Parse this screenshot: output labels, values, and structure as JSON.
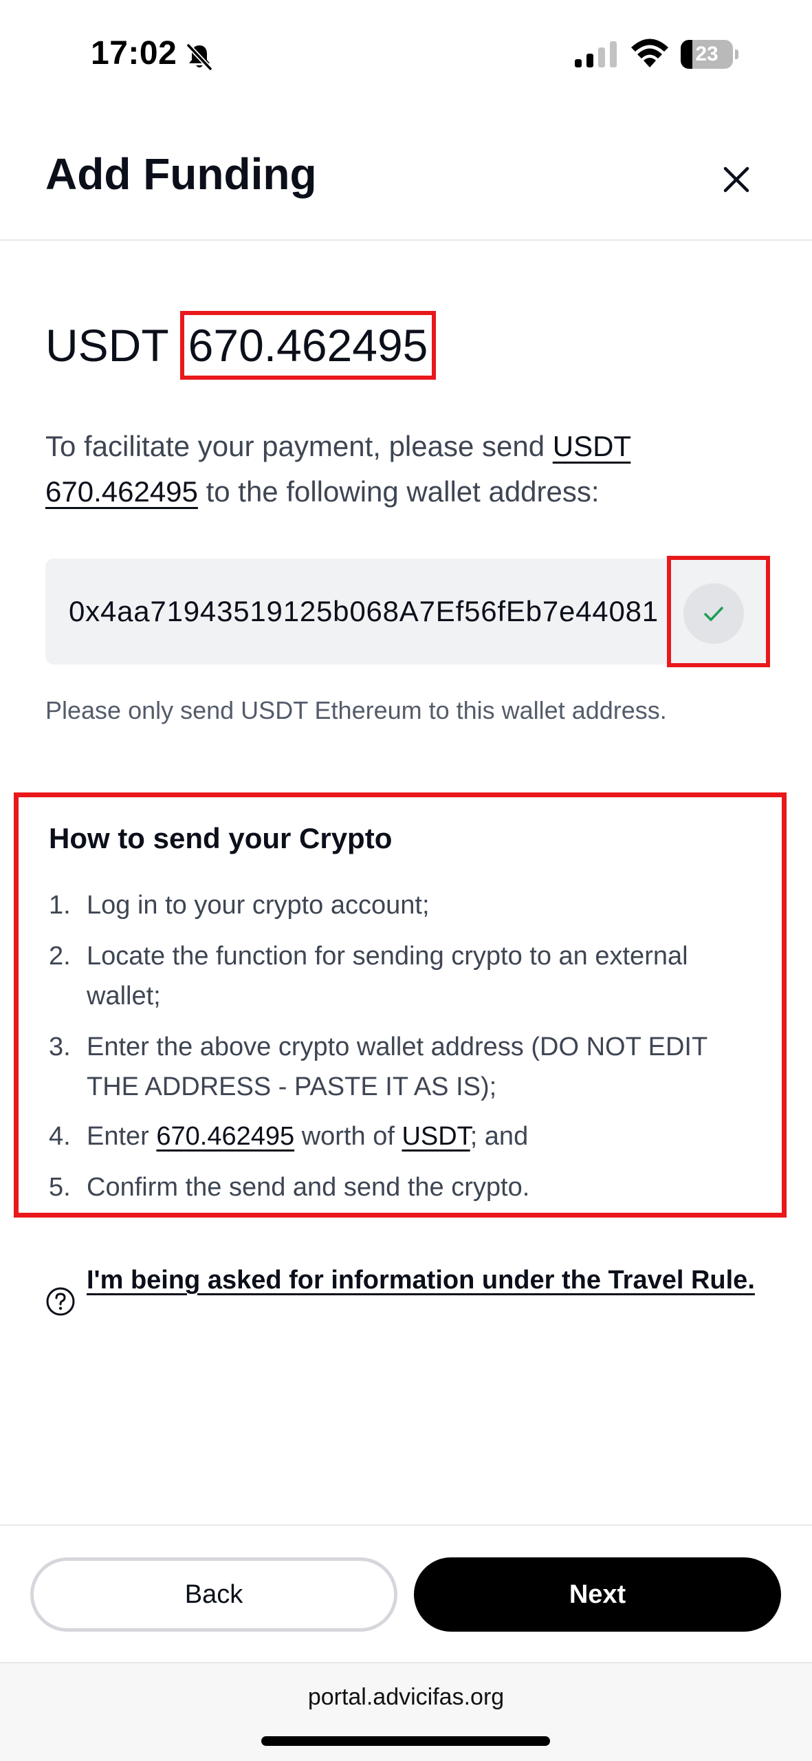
{
  "status_bar": {
    "time": "17:02",
    "battery_level": "23",
    "battery_fraction": 0.23,
    "icons": [
      "bell-slash-icon",
      "cellular-signal-icon",
      "wifi-icon",
      "battery-icon"
    ]
  },
  "header": {
    "title": "Add Funding",
    "close_icon": "close-icon"
  },
  "amount": {
    "currency": "USDT",
    "value": "670.462495"
  },
  "description": {
    "prefix": "To facilitate your payment, please send ",
    "link_currency": "USDT",
    "link_amount": "670.462495",
    "suffix": " to the following wallet address:"
  },
  "wallet": {
    "address": "0x4aa71943519125b068A7Ef56fEb7e44081",
    "copy_icon": "check-icon",
    "note": "Please only send USDT Ethereum to this wallet address."
  },
  "instructions": {
    "title": "How to send your Crypto",
    "steps": [
      {
        "number": "1.",
        "text": "Log in to your crypto account;"
      },
      {
        "number": "2.",
        "text": "Locate the function for sending crypto to an external wallet;"
      },
      {
        "number": "3.",
        "text": "Enter the above crypto wallet address (DO NOT EDIT THE ADDRESS - PASTE IT AS IS);"
      },
      {
        "number": "4.",
        "prefix": "Enter ",
        "amount": "670.462495",
        "middle": " worth of ",
        "currency": "USDT",
        "suffix": "; and"
      },
      {
        "number": "5.",
        "text": "Confirm the send and send the crypto."
      }
    ]
  },
  "travel_rule": {
    "icon": "help-circle-icon",
    "link_text": "I'm being asked for information under the Travel Rule."
  },
  "actions": {
    "back_label": "Back",
    "next_label": "Next"
  },
  "browser": {
    "url": "portal.advicifas.org"
  },
  "colors": {
    "highlight_red": "#e8181b",
    "primary_text": "#0b0f1a",
    "secondary_text": "#3e4553",
    "wallet_bg": "#f1f2f4",
    "success_green": "#1f9d55"
  }
}
